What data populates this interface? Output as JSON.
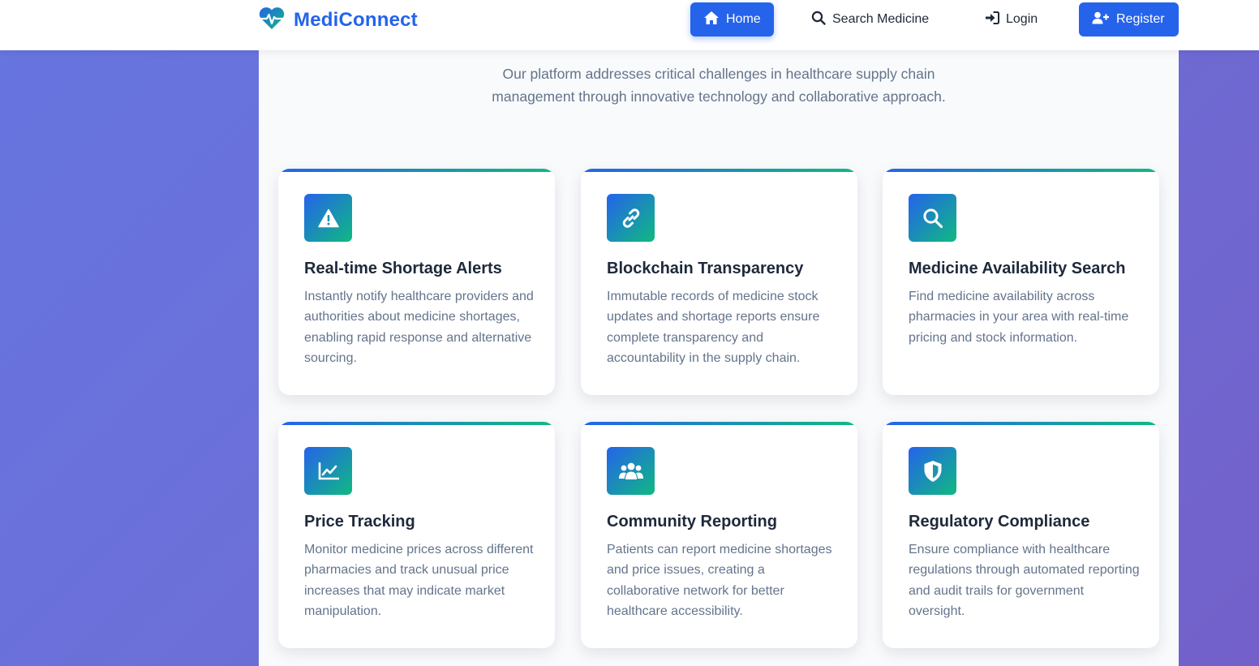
{
  "nav": {
    "brand": "MediConnect",
    "brand_icon": "heartbeat-icon",
    "items": [
      {
        "label": "Home",
        "icon": "home-icon",
        "active": true
      },
      {
        "label": "Search Medicine",
        "icon": "search-icon"
      },
      {
        "label": "Login",
        "icon": "sign-in-icon"
      },
      {
        "label": "Register",
        "icon": "user-plus-icon"
      }
    ]
  },
  "intro": "Our platform addresses critical challenges in healthcare supply chain management through innovative technology and collaborative approach.",
  "colors": {
    "primary": "#2563eb",
    "accent": "#10b981",
    "background": "#6675e0"
  },
  "features": [
    {
      "title": "Real-time Shortage Alerts",
      "icon": "warning-icon",
      "description": "Instantly notify healthcare providers and authorities about medicine shortages, enabling rapid response and alternative sourcing."
    },
    {
      "title": "Blockchain Transparency",
      "icon": "link-icon",
      "description": "Immutable records of medicine stock updates and shortage reports ensure complete transparency and accountability in the supply chain."
    },
    {
      "title": "Medicine Availability Search",
      "icon": "search-icon",
      "description": "Find medicine availability across pharmacies in your area with real-time pricing and stock information."
    },
    {
      "title": "Price Tracking",
      "icon": "chart-line-icon",
      "description": "Monitor medicine prices across different pharmacies and track unusual price increases that may indicate market manipulation."
    },
    {
      "title": "Community Reporting",
      "icon": "users-icon",
      "description": "Patients can report medicine shortages and price issues, creating a collaborative network for better healthcare accessibility."
    },
    {
      "title": "Regulatory Compliance",
      "icon": "shield-icon",
      "description": "Ensure compliance with healthcare regulations through automated reporting and audit trails for government oversight."
    }
  ]
}
